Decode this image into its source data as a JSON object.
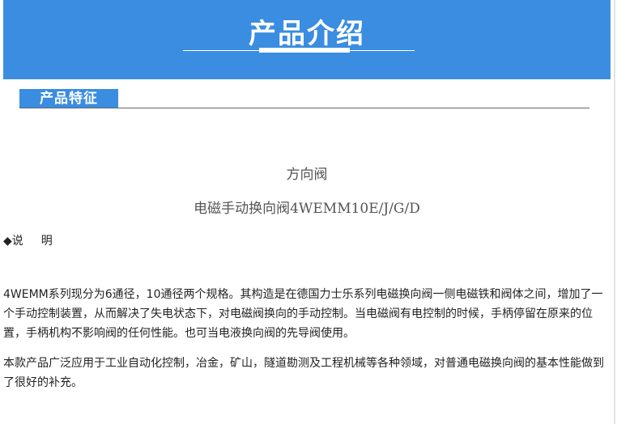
{
  "banner": {
    "title": "产品介绍"
  },
  "section": {
    "heading": "产品特征"
  },
  "product": {
    "category": "方向阀",
    "name": "电磁手动换向阀4WEMM10E/J/G/D"
  },
  "explain": {
    "bullet": "◆说",
    "word": "明"
  },
  "paragraphs": [
    "4WEMM系列现分为6通径，10通径两个规格。其构造是在德国力士乐系列电磁换向阀一侧电磁铁和阀体之间，增加了一个手动控制装置，从而解决了失电状态下，对电磁阀换向的手动控制。当电磁阀有电控制的时候，手柄停留在原来的位置，手柄机构不影响阀的任何性能。也可当电液换向阀的先导阀使用。",
    "本款产品广泛应用于工业自动化控制，冶金，矿山，隧道勘测及工程机械等各种领域，对普通电磁换向阀的基本性能做到了很好的补充。"
  ]
}
